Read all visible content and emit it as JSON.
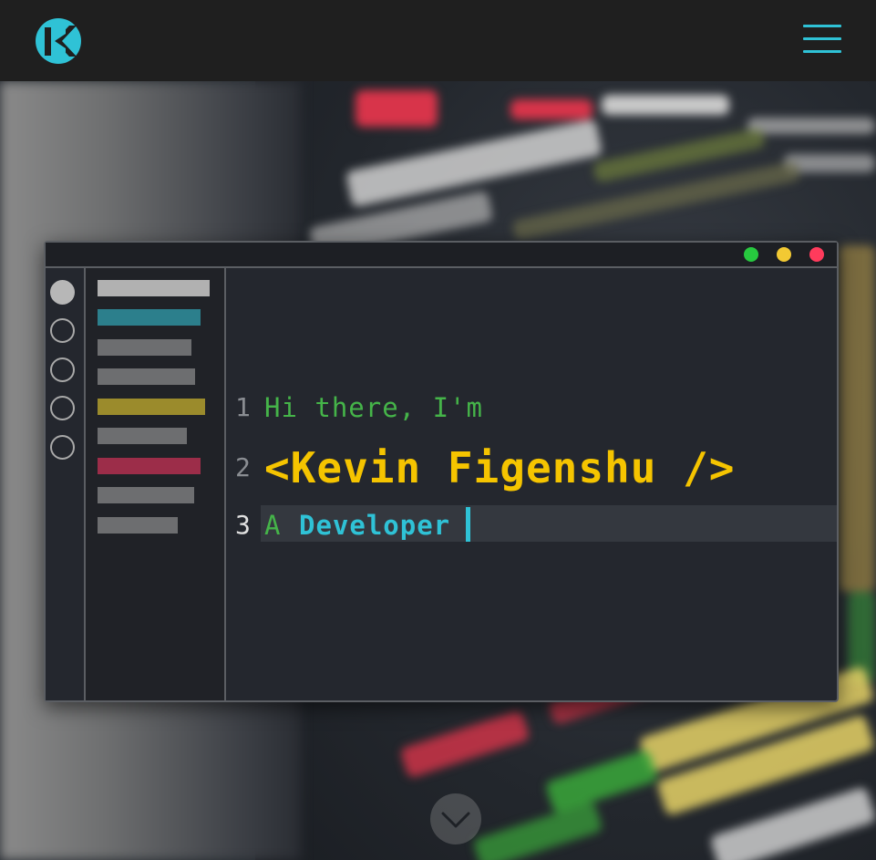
{
  "header": {
    "logo_icon": "k-logo-icon",
    "menu_icon": "hamburger-menu-icon",
    "accent": "#2fc2d6"
  },
  "editor": {
    "window_controls": [
      {
        "name": "maximize",
        "color": "#27c93f"
      },
      {
        "name": "minimize",
        "color": "#f2c933"
      },
      {
        "name": "close",
        "color": "#ff3b5c"
      }
    ],
    "file_tree_colors": [
      "#b1b1b1",
      "#2c7f8c",
      "#6d6e70",
      "#6d6e70",
      "#9b8b2c",
      "#6d6e70",
      "#9c2d49",
      "#6d6e70",
      "#6d6e70"
    ],
    "lines": [
      {
        "number": "1",
        "text": "Hi there, I'm"
      },
      {
        "number": "2",
        "text": "<Kevin Figenshu />"
      },
      {
        "number": "3",
        "prefix": "A",
        "text": "Developer"
      }
    ]
  },
  "scroll_icon": "chevron-down-icon"
}
